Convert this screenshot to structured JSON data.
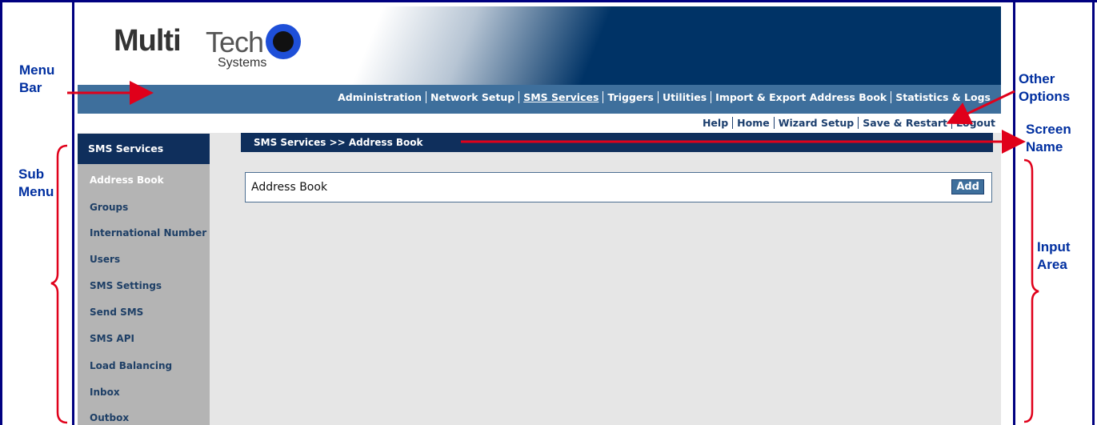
{
  "annotations": {
    "menu_bar": [
      "Menu",
      "Bar"
    ],
    "sub_menu": [
      "Sub",
      "Menu"
    ],
    "other_options": [
      "Other",
      "Options"
    ],
    "screen_name": [
      "Screen",
      "Name"
    ],
    "input_area": [
      "Input",
      "Area"
    ]
  },
  "logo": {
    "multi": "Multi",
    "tech": "Tech",
    "systems": "Systems"
  },
  "menu": {
    "items": [
      "Administration",
      "Network Setup",
      "SMS Services",
      "Triggers",
      "Utilities",
      "Import & Export Address Book",
      "Statistics & Logs"
    ],
    "active": "SMS Services"
  },
  "options": {
    "items": [
      "Help",
      "Home",
      "Wizard Setup",
      "Save & Restart",
      "Logout"
    ]
  },
  "sidebar": {
    "heading": "SMS Services",
    "items": [
      "Address Book",
      "Groups",
      "International Number",
      "Users",
      "SMS Settings",
      "Send SMS",
      "SMS API",
      "Load Balancing",
      "Inbox",
      "Outbox"
    ],
    "active": "Address Book"
  },
  "breadcrumb": "SMS Services >> Address Book",
  "panel": {
    "title": "Address Book",
    "add_label": "Add"
  },
  "colors": {
    "header_navy": "#003366",
    "menubar_blue": "#3e6f9c",
    "annotation_blue": "#002FA0",
    "arrow_red": "#e0001a"
  }
}
